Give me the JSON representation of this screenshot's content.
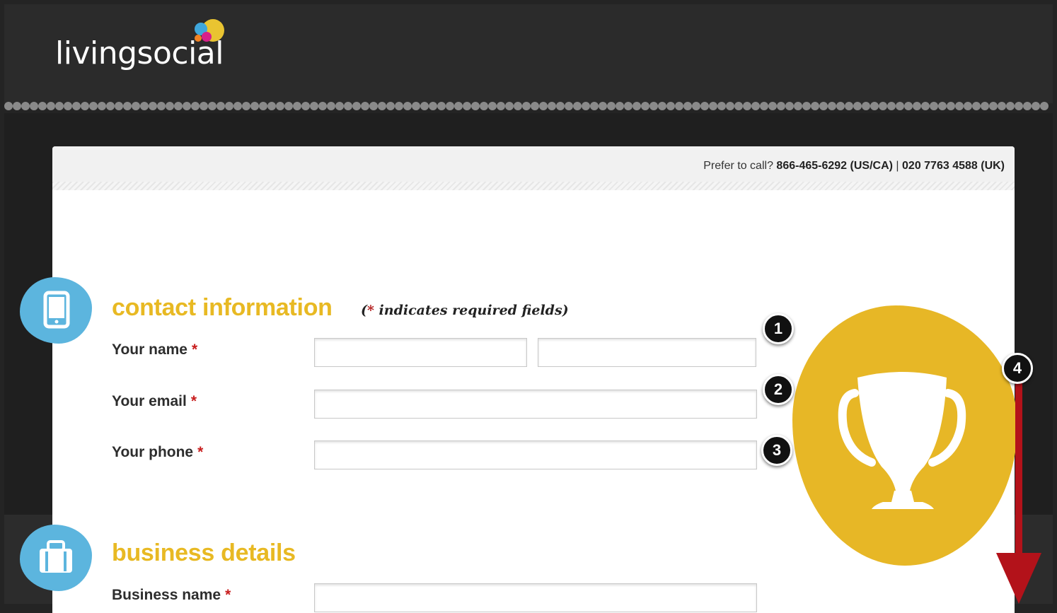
{
  "header": {
    "logo_text": "livingsocial",
    "logo_dot_colors": [
      "#e9c431",
      "#3fa7dc",
      "#d7208a",
      "#f08224"
    ]
  },
  "call_bar": {
    "prefix": "Prefer to call?",
    "us_phone": "866-465-6292 (US/CA)",
    "separator": "|",
    "uk_phone": "020 7763 4588 (UK)"
  },
  "contact_section": {
    "title": "contact information",
    "required_note_open": "(",
    "required_star": "*",
    "required_note_text": " indicates required fields)",
    "icon": "mobile-phone-icon",
    "fields": {
      "name_label": "Your name",
      "email_label": "Your email",
      "phone_label": "Your phone",
      "required_marker": "*",
      "first_name_value": "",
      "last_name_value": "",
      "email_value": "",
      "phone_value": ""
    }
  },
  "business_section": {
    "title": "business details",
    "icon": "briefcase-icon",
    "fields": {
      "business_name_label": "Business name",
      "required_marker": "*",
      "business_name_value": ""
    }
  },
  "callouts": [
    "1",
    "2",
    "3",
    "4"
  ],
  "colors": {
    "accent_yellow": "#e8b923",
    "icon_blue": "#5cb5de",
    "arrow_red": "#b3121a",
    "required_red": "#c81e1e"
  },
  "decor": {
    "trophy_icon": "trophy-icon",
    "arrow": "down-arrow-annotation"
  }
}
